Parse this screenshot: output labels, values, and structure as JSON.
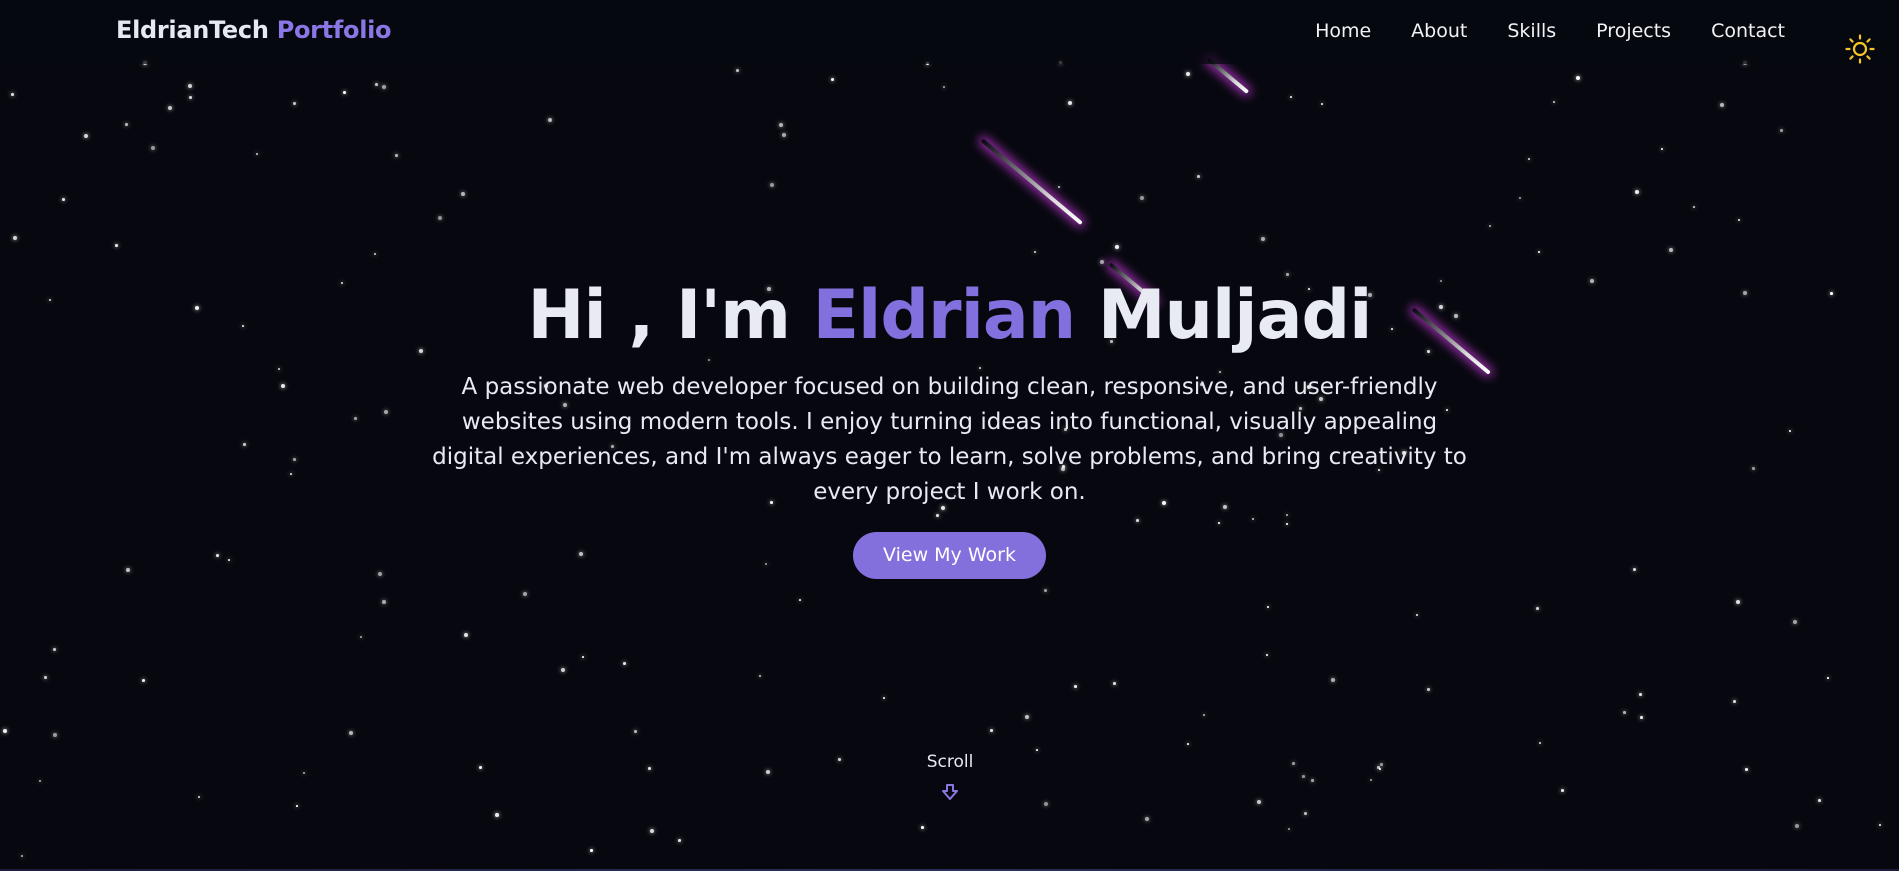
{
  "navbar": {
    "brand_main": "EldrianTech",
    "brand_accent": "Portfolio",
    "links": [
      "Home",
      "About",
      "Skills",
      "Projects",
      "Contact"
    ],
    "theme_icon": "sun-icon"
  },
  "hero": {
    "greeting": "Hi , I'm",
    "first_name": "Eldrian",
    "last_name": "Muljadi",
    "description": "A passionate web developer focused on building clean, responsive, and user-friendly websites using modern tools. I enjoy turning ideas into functional, visually appealing digital experiences, and I'm always eager to learn, solve problems, and bring creativity to every project I work on.",
    "cta_label": "View My Work"
  },
  "scroll": {
    "label": "Scroll",
    "icon": "arrow-down-icon"
  },
  "colors": {
    "background": "#07080f",
    "accent": "#8270de",
    "button": "#8470dc",
    "sun": "#f7c623",
    "meteor_glow": "#d23ce6"
  }
}
